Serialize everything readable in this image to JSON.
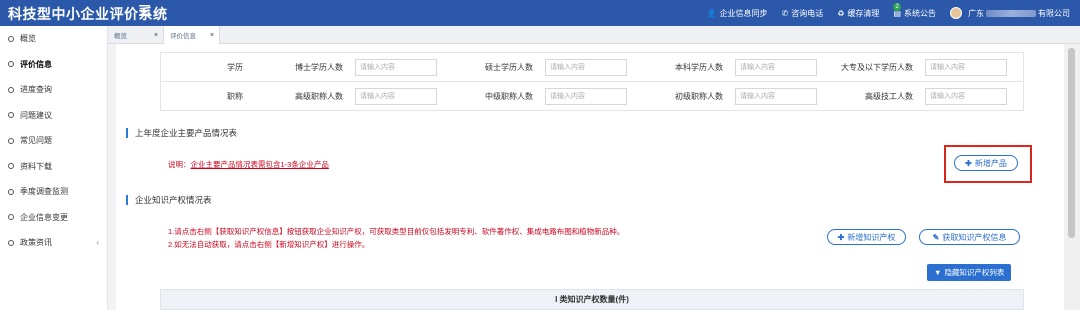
{
  "app": {
    "title": "科技型中小企业评价系统"
  },
  "header": {
    "links": [
      {
        "icon": "user-icon",
        "label": "企业信息同步"
      },
      {
        "icon": "phone-icon",
        "label": "咨询电话"
      },
      {
        "icon": "recycle-icon",
        "label": "缓存清理"
      },
      {
        "icon": "notice-icon",
        "label": "系统公告",
        "badge": "2"
      }
    ],
    "company_prefix": "广东",
    "company_suffix": "有限公司"
  },
  "sidebar": {
    "items": [
      {
        "label": "概览"
      },
      {
        "label": "评价信息",
        "active": true
      },
      {
        "label": "进度查询"
      },
      {
        "label": "问题建议"
      },
      {
        "label": "常见问题"
      },
      {
        "label": "资料下载"
      },
      {
        "label": "季度调查监测"
      },
      {
        "label": "企业信息变更"
      },
      {
        "label": "政策资讯",
        "has_children": true
      }
    ]
  },
  "tabs": [
    {
      "label": "概览",
      "close": "×"
    },
    {
      "label": "评价信息",
      "close": "×",
      "active": true
    }
  ],
  "staff": {
    "placeholder": "请输入内容",
    "rows": [
      {
        "category": "学历",
        "fields": [
          "博士学历人数",
          "硕士学历人数",
          "本科学历人数",
          "大专及以下学历人数"
        ]
      },
      {
        "category": "职称",
        "fields": [
          "高级职称人数",
          "中级职称人数",
          "初级职称人数",
          "高级技工人数"
        ]
      }
    ]
  },
  "products": {
    "title": "上年度企业主要产品情况表",
    "note_prefix": "说明：",
    "note_text": "企业主要产品情况表需包含1-3条企业产品",
    "add_button": "新增产品"
  },
  "ip": {
    "title": "企业知识产权情况表",
    "note1": "1.请点击右侧【获取知识产权信息】按钮获取企业知识产权，可获取类型目前仅包括发明专利、软件著作权、集成电路布图和植物新品种。",
    "note2": "2.如无法自动获取，请点击右侧【新增知识产权】进行操作。",
    "add_button": "新增知识产权",
    "fetch_button": "获取知识产权信息",
    "hide_button": "隐藏知识产权列表",
    "table_header": "I 类知识产权数量(件)"
  },
  "colors": {
    "header": "#2b58a8",
    "accent": "#2b6fd0",
    "red": "#d0021b"
  }
}
